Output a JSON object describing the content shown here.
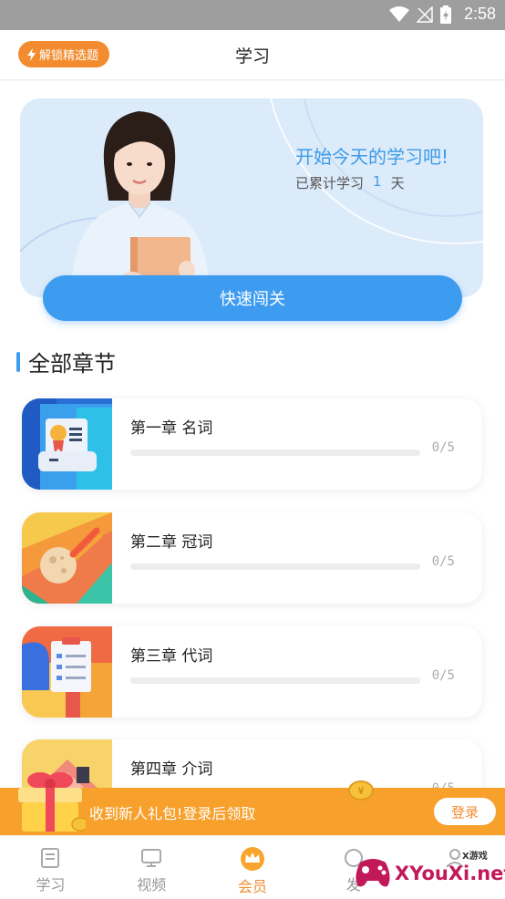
{
  "status_bar": {
    "time": "2:58"
  },
  "header": {
    "unlock_label": "解锁精选题",
    "title": "学习"
  },
  "banner": {
    "headline": "开始今天的学习吧!",
    "stat_prefix": "已累计学习",
    "stat_value": "1",
    "stat_suffix": "天",
    "quick_button": "快速闯关"
  },
  "section": {
    "title": "全部章节"
  },
  "chapters": [
    {
      "name": "第一章  名词",
      "count": "0/5",
      "progress": 0
    },
    {
      "name": "第二章  冠词",
      "count": "0/5",
      "progress": 0
    },
    {
      "name": "第三章  代词",
      "count": "0/5",
      "progress": 0
    },
    {
      "name": "第四章  介词",
      "count": "0/5",
      "progress": 0
    }
  ],
  "gift_banner": {
    "text": "收到新人礼包!登录后领取",
    "login_label": "登录"
  },
  "tabs": [
    {
      "label": "学习",
      "icon": "book-icon",
      "active": false
    },
    {
      "label": "视频",
      "icon": "monitor-icon",
      "active": false
    },
    {
      "label": "会员",
      "icon": "crown-icon",
      "active": true
    },
    {
      "label": "发",
      "icon": "discover-icon",
      "active": false
    },
    {
      "label": "",
      "icon": "profile-icon",
      "active": false
    }
  ],
  "watermark": {
    "text": "XYouXi.net",
    "small": "X游戏"
  },
  "colors": {
    "accent_blue": "#3d9cf0",
    "accent_orange": "#f28c2f",
    "gift_orange": "#f7a02c"
  }
}
